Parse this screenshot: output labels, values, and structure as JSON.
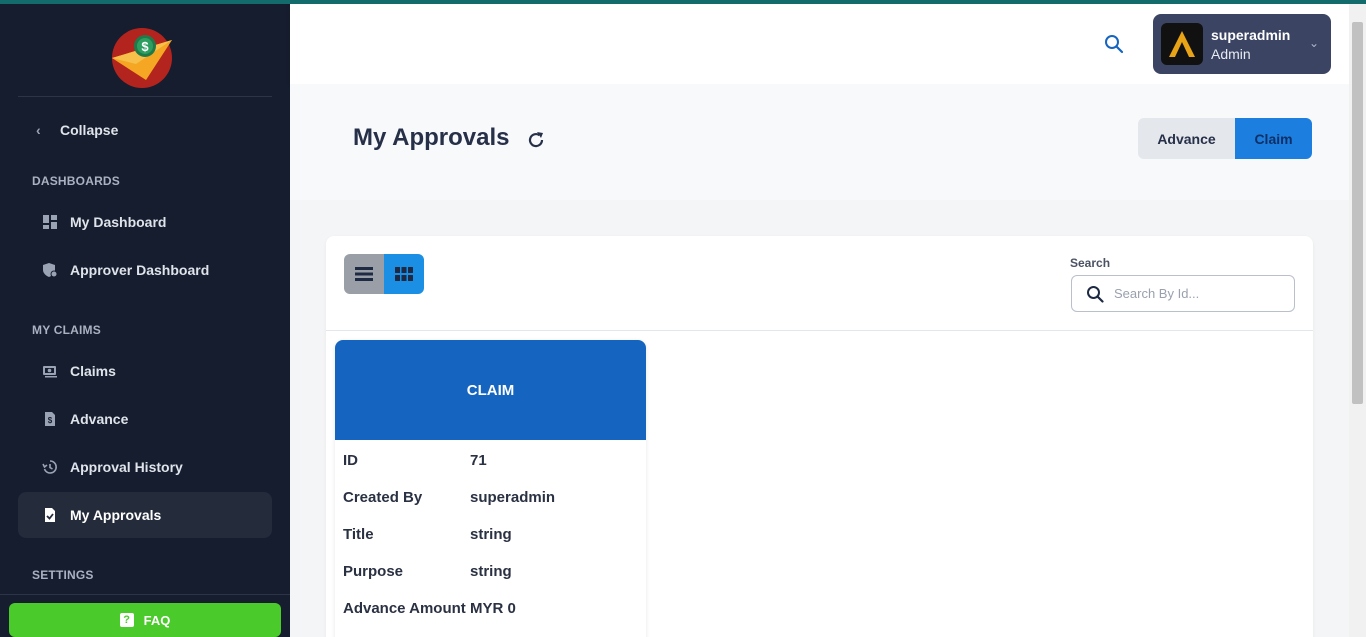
{
  "sidebar": {
    "collapse_label": "Collapse",
    "sections": {
      "dashboards": "DASHBOARDS",
      "my_claims": "MY CLAIMS",
      "settings": "SETTINGS"
    },
    "items": [
      {
        "label": "My Dashboard",
        "icon": "dashboard-icon"
      },
      {
        "label": "Approver Dashboard",
        "icon": "approver-dashboard-icon"
      },
      {
        "label": "Claims",
        "icon": "claims-icon"
      },
      {
        "label": "Advance",
        "icon": "advance-icon"
      },
      {
        "label": "Approval History",
        "icon": "history-icon"
      },
      {
        "label": "My Approvals",
        "icon": "approval-check-icon",
        "active": true
      }
    ],
    "faq_label": "FAQ"
  },
  "header": {
    "user": {
      "name": "superadmin",
      "role": "Admin"
    }
  },
  "page": {
    "title": "My Approvals",
    "tabs": {
      "advance": "Advance",
      "claim": "Claim",
      "selected": "Claim"
    }
  },
  "panel": {
    "search_label": "Search",
    "search_placeholder": "Search By Id...",
    "view_mode": "grid"
  },
  "card": {
    "header": "CLAIM",
    "rows": [
      {
        "key": "ID",
        "value": "71"
      },
      {
        "key": "Created By",
        "value": "superadmin"
      },
      {
        "key": "Title",
        "value": "string"
      },
      {
        "key": "Purpose",
        "value": "string"
      },
      {
        "key": "Advance Amount",
        "value": "MYR 0"
      }
    ]
  },
  "colors": {
    "sidebar_bg": "#161d2e",
    "accent_blue": "#1c7fe0",
    "card_header": "#1565c0",
    "faq_green": "#4bcb2b",
    "user_card": "#3b4463"
  }
}
